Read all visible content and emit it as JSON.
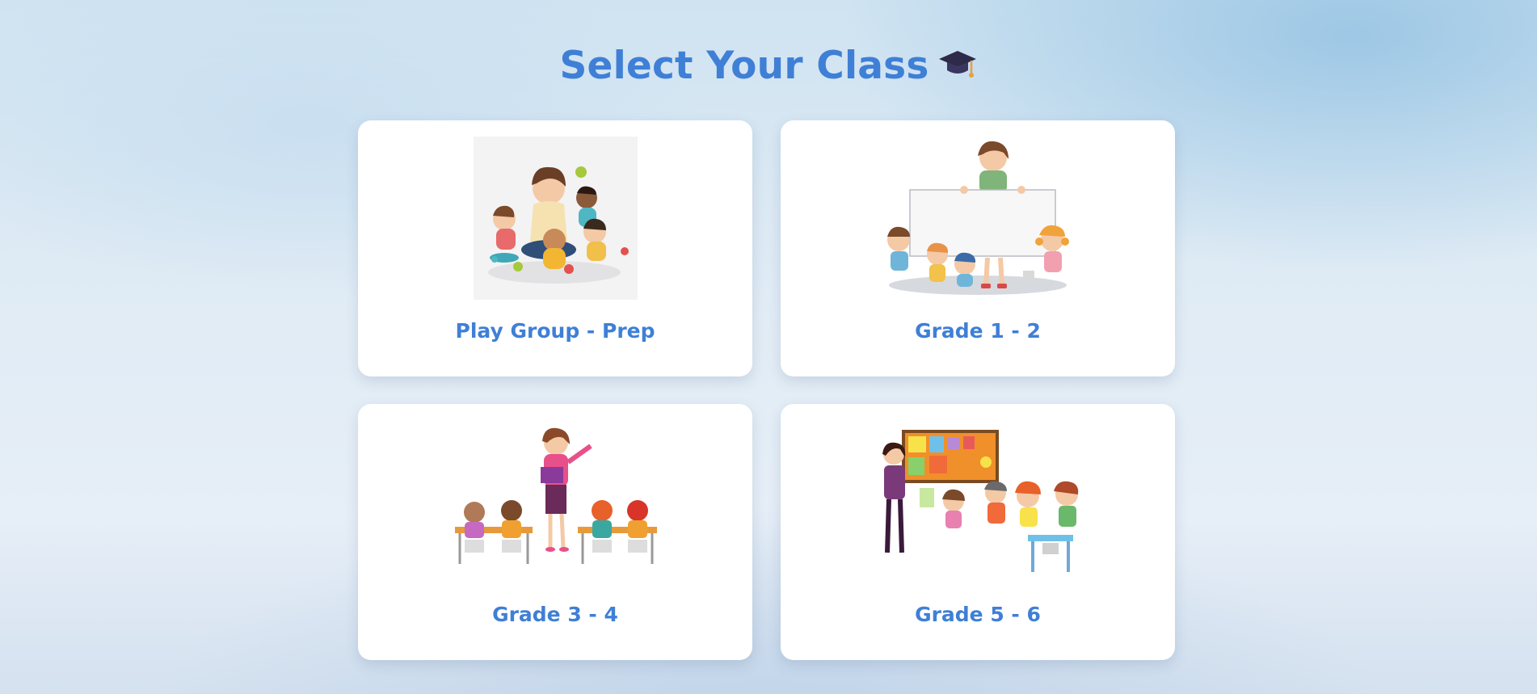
{
  "page": {
    "title": "Select Your Class",
    "title_icon": "graduation-cap-icon",
    "accent_color": "#3f7fd6"
  },
  "classes": [
    {
      "label": "Play Group - Prep",
      "illustration": "teacher-with-toddlers-playing"
    },
    {
      "label": "Grade 1 - 2",
      "illustration": "teacher-holding-blank-board-with-kids"
    },
    {
      "label": "Grade 3 - 4",
      "illustration": "teacher-reading-to-seated-students"
    },
    {
      "label": "Grade 5 - 6",
      "illustration": "teacher-at-bulletin-board-with-students"
    }
  ]
}
